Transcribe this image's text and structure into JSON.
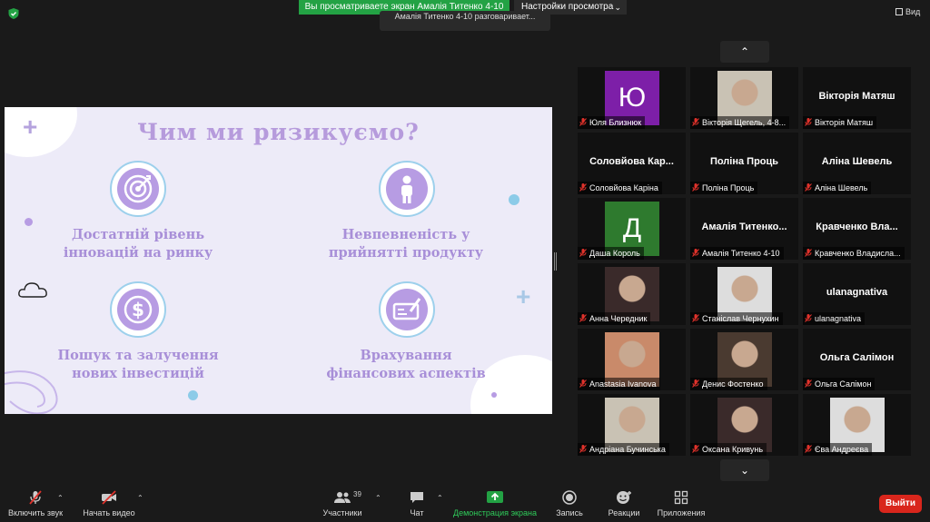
{
  "top": {
    "banner": "Вы просматриваете экран Амалія Титенко 4-10",
    "view_settings": "Настройки просмотра",
    "talking": "Амалія Титенко 4-10 разговаривает...",
    "view_label": "Вид"
  },
  "slide": {
    "title": "Чим ми ризикуємо?",
    "items": [
      {
        "line1": "Достатній рівень",
        "line2": "інновацій на ринку",
        "icon": "target-icon"
      },
      {
        "line1": "Невпевненість у",
        "line2": "прийнятті продукту",
        "icon": "person-icon"
      },
      {
        "line1": "Пошук та залучення",
        "line2": "нових інвестицій",
        "icon": "dollar-coin-icon"
      },
      {
        "line1": "Врахування",
        "line2": "фінансових аспектів",
        "icon": "check-signing-icon"
      }
    ]
  },
  "participants": [
    {
      "label": "Юля Близнюк",
      "type": "letter",
      "letter": "Ю",
      "color": "#7d1fa8"
    },
    {
      "label": "Вікторія Щегель, 4-8...",
      "type": "photo"
    },
    {
      "label": "Вікторія Матяш",
      "type": "name",
      "name": "Вікторія Матяш"
    },
    {
      "label": "Соловйова Каріна",
      "type": "name",
      "name": "Соловйова Кар..."
    },
    {
      "label": "Поліна Проць",
      "type": "name",
      "name": "Поліна Проць"
    },
    {
      "label": "Аліна Шевель",
      "type": "name",
      "name": "Аліна Шевель"
    },
    {
      "label": "Даша Король",
      "type": "letter",
      "letter": "Д",
      "color": "#2e7a2e"
    },
    {
      "label": "Амалія Титенко 4-10",
      "type": "name",
      "name": "Амалія Титенко..."
    },
    {
      "label": "Кравченко Владисла...",
      "type": "name",
      "name": "Кравченко Вла..."
    },
    {
      "label": "Анна Чередник",
      "type": "photo"
    },
    {
      "label": "Станіслав Чернухин",
      "type": "photo"
    },
    {
      "label": "ulanagnativa",
      "type": "name",
      "name": "ulanagnativa"
    },
    {
      "label": "Anastasia Ivanova",
      "type": "photo"
    },
    {
      "label": "Денис Фостенко",
      "type": "photo"
    },
    {
      "label": "Ольга Салімон",
      "type": "name",
      "name": "Ольга Салімон"
    },
    {
      "label": "Андріана Бучинська",
      "type": "photo"
    },
    {
      "label": "Оксана Кривунь",
      "type": "photo"
    },
    {
      "label": "Єва Андреєва",
      "type": "photo"
    }
  ],
  "toolbar": {
    "unmute": "Включить звук",
    "start_video": "Начать видео",
    "participants": "Участники",
    "participants_count": "39",
    "chat": "Чат",
    "share_screen": "Демонстрация экрана",
    "record": "Запись",
    "reactions": "Реакции",
    "apps": "Приложения",
    "leave": "Выйти"
  },
  "colors": {
    "share_green": "#23a244",
    "leave_red": "#d9261c",
    "slide_bg": "#edebf8",
    "slide_purple": "#b79ce3"
  }
}
